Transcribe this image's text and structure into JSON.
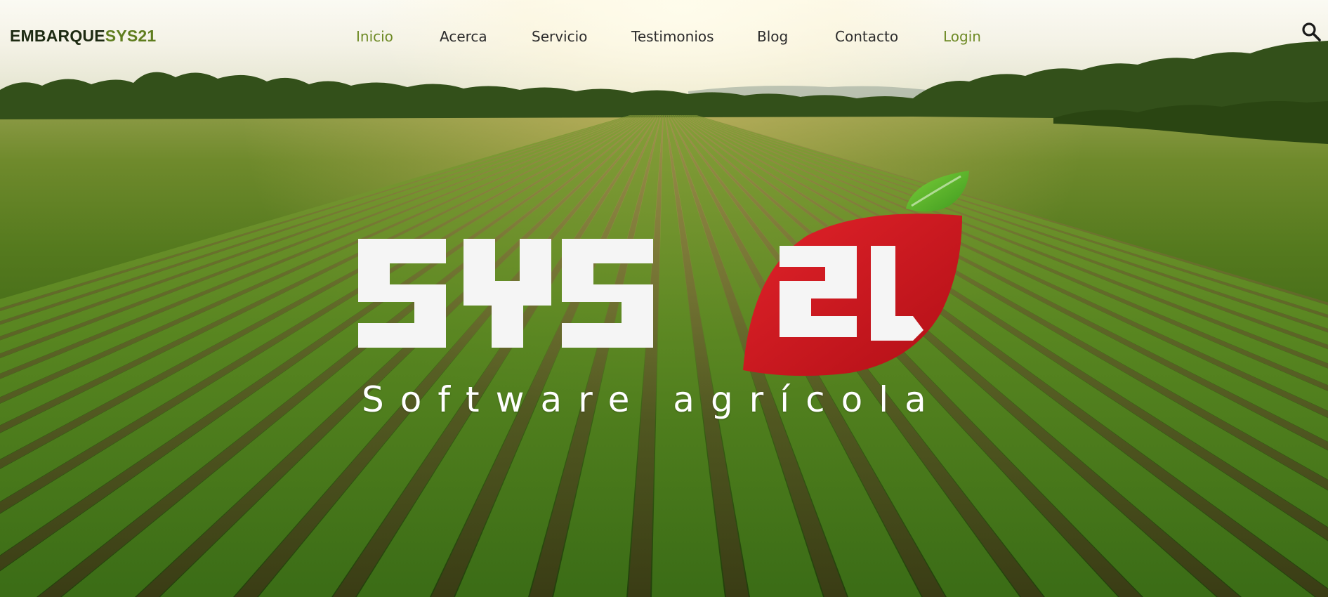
{
  "brand": {
    "part1": "EMBARQUE",
    "part2": "SYS21",
    "dark_color": "#1d2a12",
    "accent_color": "#5f7d1e"
  },
  "nav": {
    "items": [
      {
        "label": "Inicio",
        "active": true
      },
      {
        "label": "Acerca",
        "active": false
      },
      {
        "label": "Servicio",
        "active": false
      },
      {
        "label": "Testimonios",
        "active": false
      },
      {
        "label": "Blog",
        "active": false
      },
      {
        "label": "Contacto",
        "active": false
      }
    ],
    "login_label": "Login",
    "active_color": "#6e8a25",
    "search_icon": "search-icon"
  },
  "hero": {
    "logo_text": "SYS",
    "logo_number": "21",
    "tagline": "Software agrícola",
    "logo_red": "#d0151c",
    "leaf_green": "#5cb82a",
    "background": "vineyard-landscape"
  }
}
